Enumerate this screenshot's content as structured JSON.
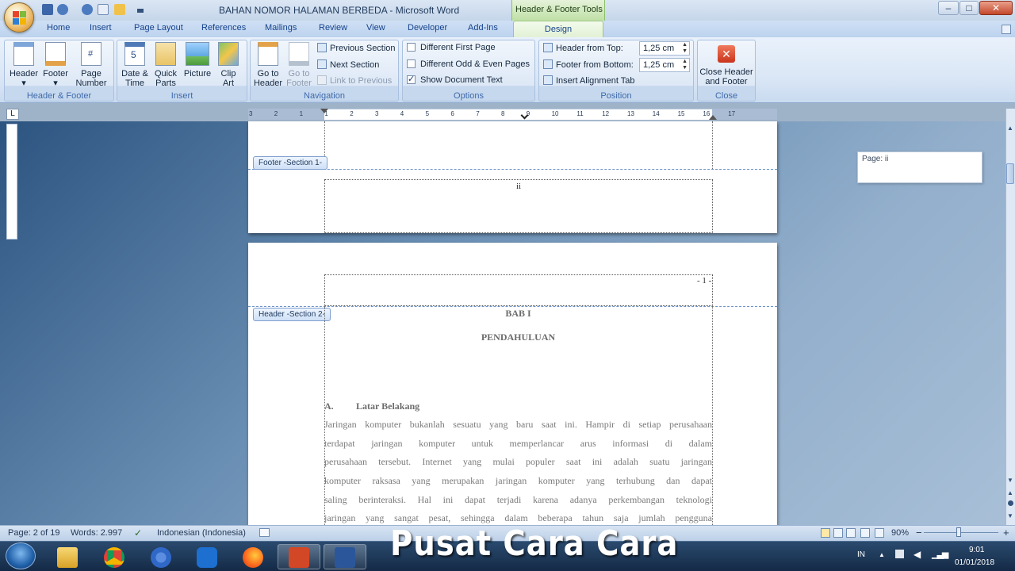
{
  "window": {
    "title": "BAHAN NOMOR HALAMAN BERBEDA - Microsoft Word",
    "context_tab": "Header & Footer Tools",
    "minimize": "–",
    "maximize": "□",
    "close": "✕"
  },
  "tabs": [
    "Home",
    "Insert",
    "Page Layout",
    "References",
    "Mailings",
    "Review",
    "View",
    "Developer",
    "Add-Ins"
  ],
  "active_tab": "Design",
  "ribbon": {
    "hf_group": {
      "label": "Header & Footer",
      "header": "Header",
      "footer": "Footer",
      "page_number": "Page Number"
    },
    "insert_group": {
      "label": "Insert",
      "date_time": "Date & Time",
      "quick_parts": "Quick Parts",
      "picture": "Picture",
      "clip_art": "Clip Art"
    },
    "navigation_group": {
      "label": "Navigation",
      "go_header": "Go to Header",
      "go_footer": "Go to Footer",
      "prev_section": "Previous Section",
      "next_section": "Next Section",
      "link_prev": "Link to Previous"
    },
    "options_group": {
      "label": "Options",
      "diff_first": "Different First Page",
      "diff_odd_even": "Different Odd & Even Pages",
      "show_doc_text": "Show Document Text",
      "diff_first_checked": false,
      "diff_odd_even_checked": false,
      "show_doc_text_checked": true
    },
    "position_group": {
      "label": "Position",
      "header_top_label": "Header from Top:",
      "header_top_value": "1,25 cm",
      "footer_bottom_label": "Footer from Bottom:",
      "footer_bottom_value": "1,25 cm",
      "insert_align_tab": "Insert Alignment Tab"
    },
    "close_group": {
      "label": "Close",
      "close_hf": "Close Header and Footer"
    }
  },
  "ruler": {
    "ticks": [
      "3",
      "2",
      "1",
      "1",
      "2",
      "3",
      "4",
      "5",
      "6",
      "7",
      "8",
      "9",
      "10",
      "11",
      "12",
      "13",
      "14",
      "15",
      "16",
      "17"
    ]
  },
  "document": {
    "footer_label": "Footer -Section 1-",
    "footer_page_number": "ii",
    "header_label": "Header -Section 2-",
    "header_page_number": "- 1 -",
    "chapter": "BAB I",
    "chapter_title": "PENDAHULUAN",
    "subsection_number": "A.",
    "subsection_title": "Latar Belakang",
    "body_lines": [
      "Jaringan komputer bukanlah sesuatu yang baru saat ini. Hampir di setiap perusahaan",
      "terdapat jaringan komputer untuk memperlancar arus informasi di dalam",
      "perusahaan tersebut. Internet yang mulai populer saat ini adalah suatu jaringan",
      "komputer raksasa yang merupakan jaringan komputer yang terhubung dan dapat",
      "saling berinteraksi. Hal ini dapat terjadi karena adanya perkembangan teknologi",
      "jaringan yang sangat pesat, sehingga dalam beberapa tahun saja jumlah pengguna"
    ],
    "comment_bubble": "Page: ii"
  },
  "statusbar": {
    "page": "Page: 2 of 19",
    "words": "Words: 2.997",
    "language": "Indonesian (Indonesia)",
    "zoom": "90%",
    "zoom_minus": "−",
    "zoom_plus": "+"
  },
  "taskbar": {
    "watermark": "Pusat Cara Cara",
    "language": "IN",
    "time": "9:01",
    "date": "01/01/2018"
  },
  "colors": {
    "ribbon_bg": "#dbe7f6",
    "context_tab": "#bfe0a6",
    "document_bg": "#6a8fb4",
    "taskbar": "#142a46"
  }
}
